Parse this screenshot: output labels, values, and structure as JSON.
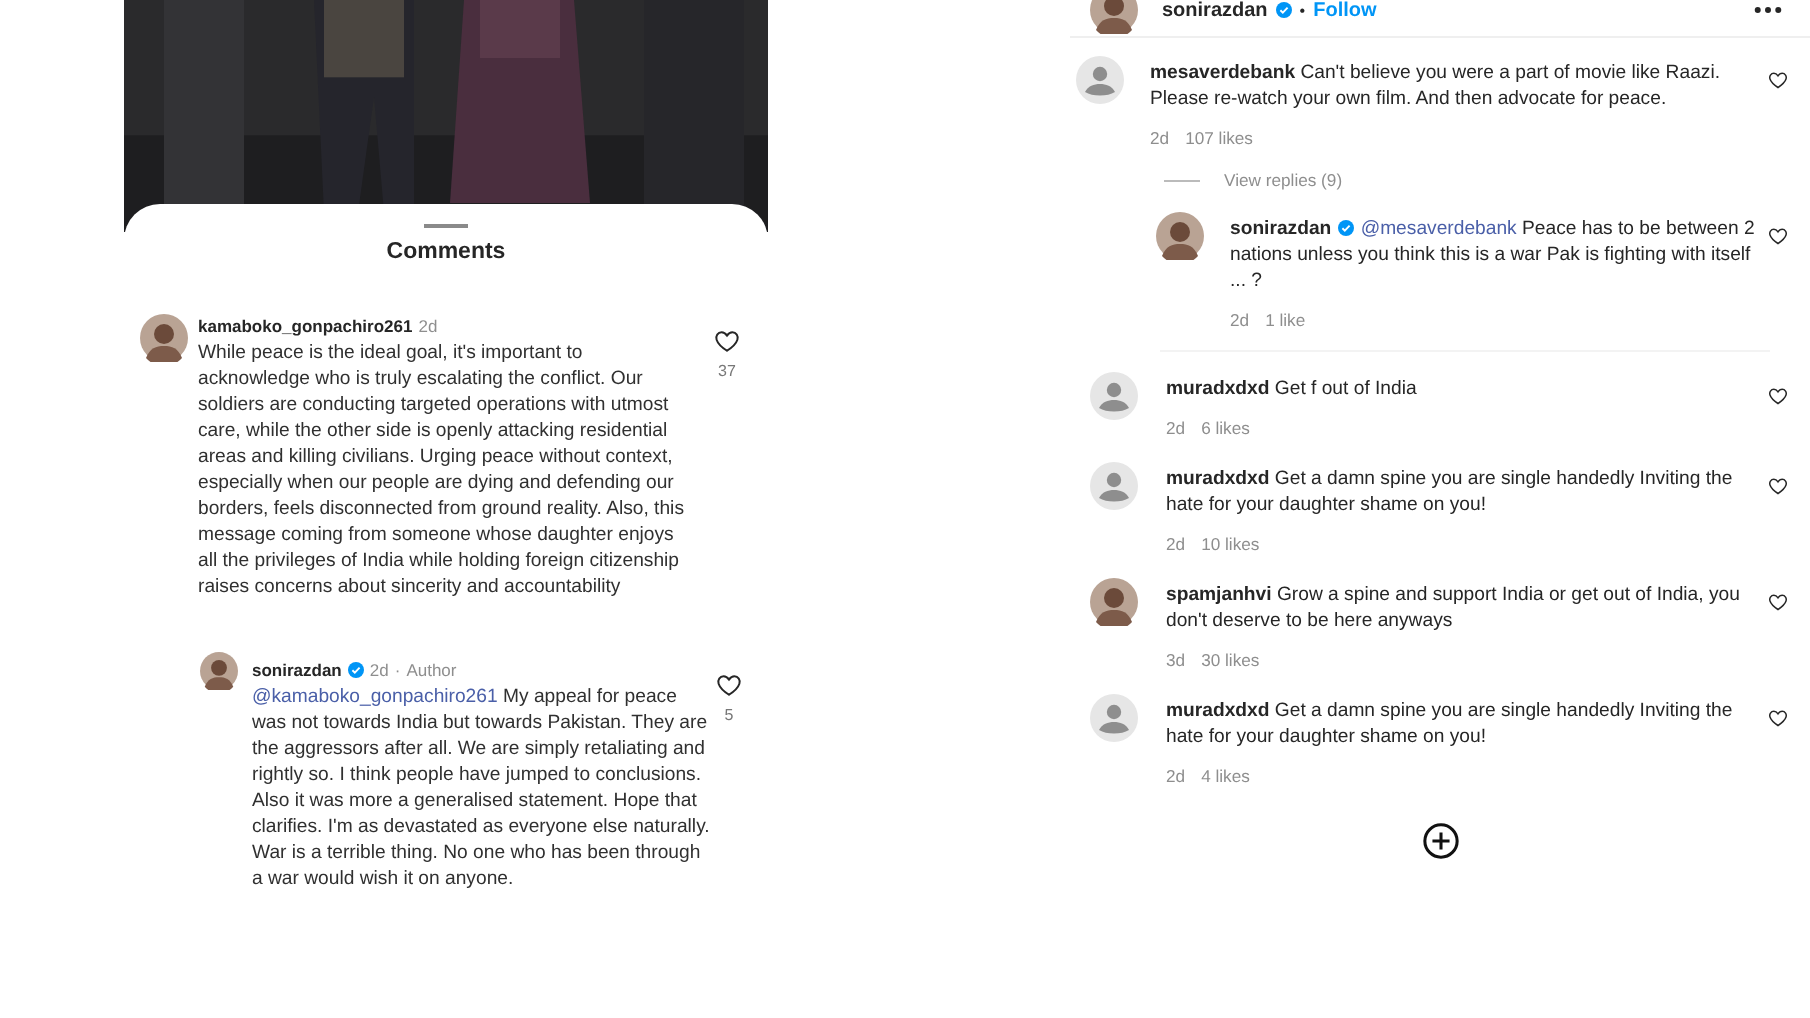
{
  "left_panel": {
    "sheet_title": "Comments",
    "comments": [
      {
        "kind": "photo-avatar",
        "username": "kamaboko_gonpachiro261",
        "verified": false,
        "time": "2d",
        "text": "While peace is the ideal goal, it's important to acknowledge who is truly escalating the conflict. Our soldiers are conducting targeted operations with utmost care, while the other side is openly attacking residential areas and killing civilians. Urging peace without context, especially when our people are dying and defending our borders, feels disconnected from ground reality. Also, this message coming from someone whose daughter enjoys all the privileges of India while holding foreign citizenship raises concerns about sincerity and accountability",
        "likes": "37",
        "replies": [
          {
            "kind": "photo-avatar",
            "username": "sonirazdan",
            "verified": true,
            "time": "2d",
            "separator": "·",
            "role": "Author",
            "mention": "@kamaboko_gonpachiro261",
            "text": "My appeal for peace was not towards India but towards Pakistan. They are the aggressors after all. We are simply retaliating and rightly so. I think people have jumped to conclusions. Also it was more a generalised statement. Hope that clarifies. I'm as devastated as everyone else naturally. War is a terrible thing. No one who has been through a war would wish it on anyone.",
            "likes": "5"
          }
        ]
      }
    ]
  },
  "right_panel": {
    "header": {
      "username": "sonirazdan",
      "verified": true,
      "separator": "•",
      "follow": "Follow"
    },
    "comments": [
      {
        "kind": "default-avatar",
        "username": "mesaverdebank",
        "verified": false,
        "text": "Can't believe you were a part of movie like Raazi. Please re-watch your own film. And then advocate for peace.",
        "time": "2d",
        "likes": "107 likes",
        "view_replies": "View replies (9)",
        "replies": [
          {
            "kind": "photo-avatar",
            "username": "sonirazdan",
            "verified": true,
            "mention": "@mesaverdebank",
            "text": "Peace has to be between 2 nations unless you think this is a war Pak is fighting with itself ... ?",
            "time": "2d",
            "likes": "1 like"
          }
        ]
      },
      {
        "kind": "default-avatar",
        "username": "muradxdxd",
        "verified": false,
        "text": "Get f out of India",
        "time": "2d",
        "likes": "6 likes"
      },
      {
        "kind": "default-avatar",
        "username": "muradxdxd",
        "verified": false,
        "text": "Get a damn spine you are single handedly Inviting the hate for your daughter shame on you!",
        "time": "2d",
        "likes": "10 likes"
      },
      {
        "kind": "photo-avatar",
        "username": "spamjanhvi",
        "verified": false,
        "text": "Grow a spine and support India or get out of India, you don't deserve to be here anyways",
        "time": "3d",
        "likes": "30 likes"
      },
      {
        "kind": "default-avatar",
        "username": "muradxdxd",
        "verified": false,
        "text": "Get a damn spine you are single handedly Inviting the hate for your daughter shame on you!",
        "time": "2d",
        "likes": "4 likes"
      }
    ]
  }
}
